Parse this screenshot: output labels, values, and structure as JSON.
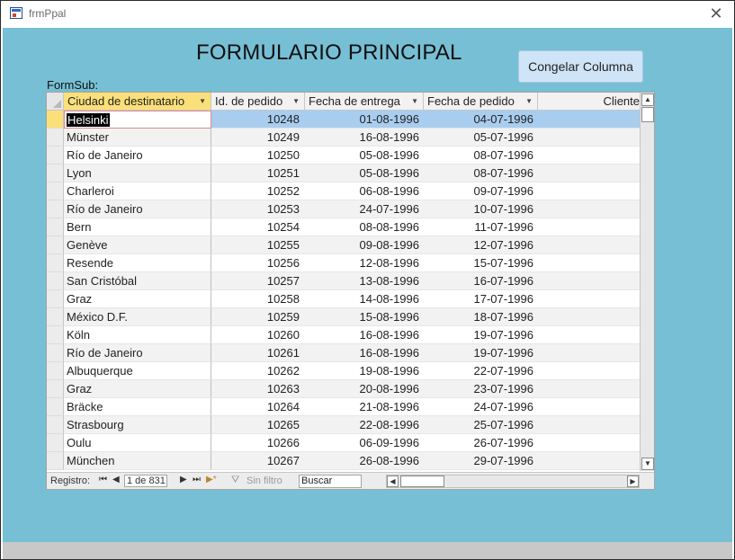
{
  "window": {
    "title": "frmPpal",
    "close_glyph": "✕",
    "icon": "form-icon"
  },
  "form": {
    "title": "FORMULARIO PRINCIPAL",
    "freeze_button_label": "Congelar Columna"
  },
  "subform": {
    "label": "FormSub:",
    "columns": [
      {
        "label": "Ciudad de destinatario",
        "active": true
      },
      {
        "label": "Id. de pedido"
      },
      {
        "label": "Fecha de entrega"
      },
      {
        "label": "Fecha de pedido"
      },
      {
        "label": "Cliente"
      }
    ],
    "rows": [
      {
        "city": "Helsinki",
        "id": "10248",
        "delivery": "01-08-1996",
        "order": "04-07-1996"
      },
      {
        "city": "Münster",
        "id": "10249",
        "delivery": "16-08-1996",
        "order": "05-07-1996"
      },
      {
        "city": "Río de Janeiro",
        "id": "10250",
        "delivery": "05-08-1996",
        "order": "08-07-1996"
      },
      {
        "city": "Lyon",
        "id": "10251",
        "delivery": "05-08-1996",
        "order": "08-07-1996"
      },
      {
        "city": "Charleroi",
        "id": "10252",
        "delivery": "06-08-1996",
        "order": "09-07-1996"
      },
      {
        "city": "Río de Janeiro",
        "id": "10253",
        "delivery": "24-07-1996",
        "order": "10-07-1996"
      },
      {
        "city": "Bern",
        "id": "10254",
        "delivery": "08-08-1996",
        "order": "11-07-1996"
      },
      {
        "city": "Genève",
        "id": "10255",
        "delivery": "09-08-1996",
        "order": "12-07-1996"
      },
      {
        "city": "Resende",
        "id": "10256",
        "delivery": "12-08-1996",
        "order": "15-07-1996"
      },
      {
        "city": "San Cristóbal",
        "id": "10257",
        "delivery": "13-08-1996",
        "order": "16-07-1996"
      },
      {
        "city": "Graz",
        "id": "10258",
        "delivery": "14-08-1996",
        "order": "17-07-1996"
      },
      {
        "city": "México D.F.",
        "id": "10259",
        "delivery": "15-08-1996",
        "order": "18-07-1996"
      },
      {
        "city": "Köln",
        "id": "10260",
        "delivery": "16-08-1996",
        "order": "19-07-1996"
      },
      {
        "city": "Río de Janeiro",
        "id": "10261",
        "delivery": "16-08-1996",
        "order": "19-07-1996"
      },
      {
        "city": "Albuquerque",
        "id": "10262",
        "delivery": "19-08-1996",
        "order": "22-07-1996"
      },
      {
        "city": "Graz",
        "id": "10263",
        "delivery": "20-08-1996",
        "order": "23-07-1996"
      },
      {
        "city": "Bräcke",
        "id": "10264",
        "delivery": "21-08-1996",
        "order": "24-07-1996"
      },
      {
        "city": "Strasbourg",
        "id": "10265",
        "delivery": "22-08-1996",
        "order": "25-07-1996"
      },
      {
        "city": "Oulu",
        "id": "10266",
        "delivery": "06-09-1996",
        "order": "26-07-1996"
      },
      {
        "city": "München",
        "id": "10267",
        "delivery": "26-08-1996",
        "order": "29-07-1996"
      }
    ],
    "navigation": {
      "label": "Registro:",
      "position": "1 de 831",
      "first": "⏮",
      "prev": "◀",
      "next": "▶",
      "last": "⏭",
      "new": "▶*",
      "filter_label": "Sin filtro",
      "search_label": "Buscar"
    }
  },
  "colors": {
    "form_background": "#77bfd4",
    "active_header": "#fbe07a",
    "selected_row": "#a9cdee",
    "button": "#cfe4f7"
  }
}
